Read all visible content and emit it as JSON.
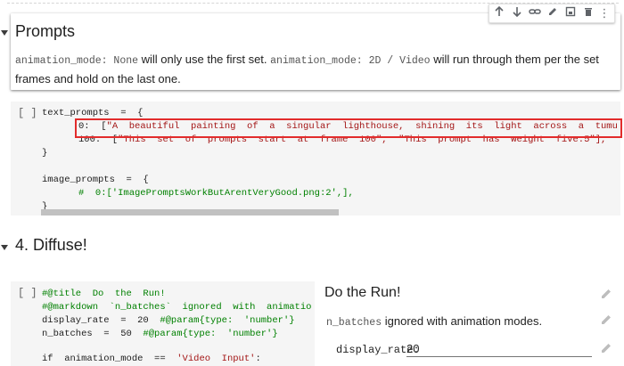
{
  "text_cell": {
    "heading": "Prompts",
    "para": {
      "code1": "animation_mode: None",
      "text1": " will only use the first set. ",
      "code2": "animation_mode: 2D / Video",
      "text2": " will run through them per the set frames and hold on the last one."
    }
  },
  "toolbar": {
    "up": "↑",
    "down": "↓",
    "link": "link",
    "edit": "edit",
    "mirror": "mirror",
    "delete": "delete",
    "more": "⋮"
  },
  "code_cell_1": {
    "run_label": "[ ]",
    "lines": {
      "l1": "text_prompts  =  {",
      "l2_key": "0:  [",
      "l2_str": "\"A  beautiful  painting  of  a  singular  lighthouse,  shining  its  light  across  a  tumultuous  sea  of  b",
      "l3_key": "100:  [",
      "l3_str": "\"This  set  of  prompts  start  at  frame  100\",  \"This  prompt  has  weight  five:5\"],",
      "l4": "}",
      "l5": "image_prompts  =  {",
      "l6": "#  0:['ImagePromptsWorkButArentVeryGood.png:2',],",
      "l7": "}"
    }
  },
  "section": {
    "heading": "4. Diffuse!"
  },
  "code_cell_2": {
    "run_label": "[ ]",
    "lines": {
      "l1": "#@title  Do  the  Run!",
      "l2": "#@markdown  `n_batches`  ignored  with  animation  modes.",
      "l3a": "display_rate  =  20  ",
      "l3b": "#@param{type:  'number'}",
      "l4a": "n_batches  =  50  ",
      "l4b": "#@param{type:  'number'}",
      "l5a": "if  animation_mode  ==  ",
      "l5b": "'Video  Input'",
      "l5c": ":"
    }
  },
  "form": {
    "title": "Do the Run!",
    "note_code": "n_batches",
    "note_text": " ignored with animation modes.",
    "display_rate_label": "display_rate:",
    "display_rate_value": "20"
  },
  "colors": {
    "highlight_box": "#e22c2c",
    "code_bg": "#f5f5f5",
    "string": "#a31515",
    "comment": "#008000"
  }
}
